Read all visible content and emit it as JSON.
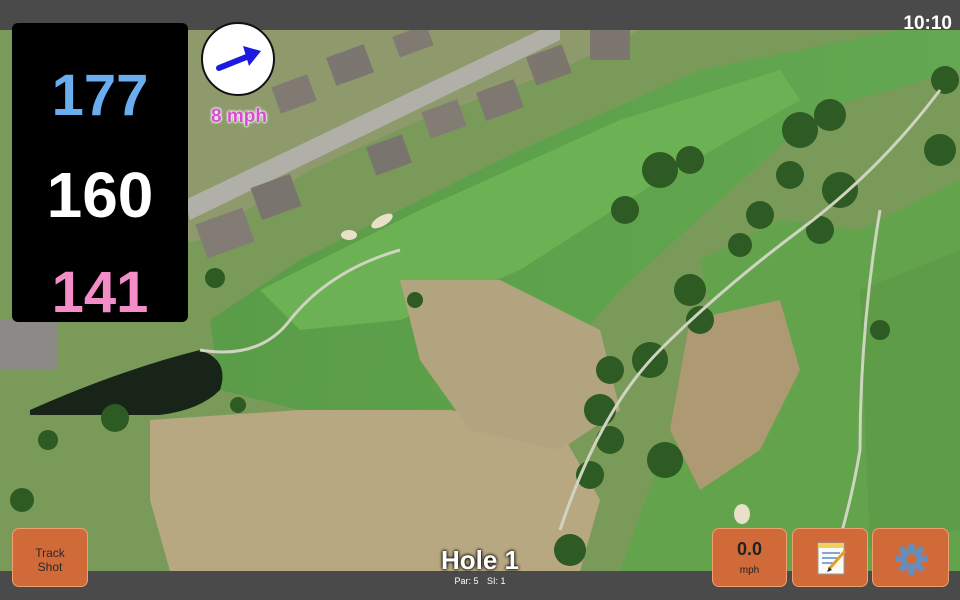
{
  "status": {
    "time": "10:10"
  },
  "distances": {
    "back": "177",
    "middle": "160",
    "front": "141",
    "colors": {
      "back": "#6aaef0",
      "middle": "#ffffff",
      "front": "#f48cc8"
    }
  },
  "wind": {
    "speed_label": "8 mph",
    "direction_icon": "arrow-right-icon",
    "arrow_color": "#1a1ae0",
    "speed_color": "#d84dd0"
  },
  "buttons": {
    "track_shot": {
      "line1": "Track",
      "line2": "Shot"
    },
    "wind_readout": {
      "value": "0.0",
      "unit": "mph"
    },
    "notes": {
      "icon": "notepad-icon"
    },
    "settings": {
      "icon": "gear-icon"
    },
    "button_color": "#d06a38"
  },
  "hole": {
    "title": "Hole 1",
    "par": "Par: 5",
    "si": "SI: 1"
  }
}
